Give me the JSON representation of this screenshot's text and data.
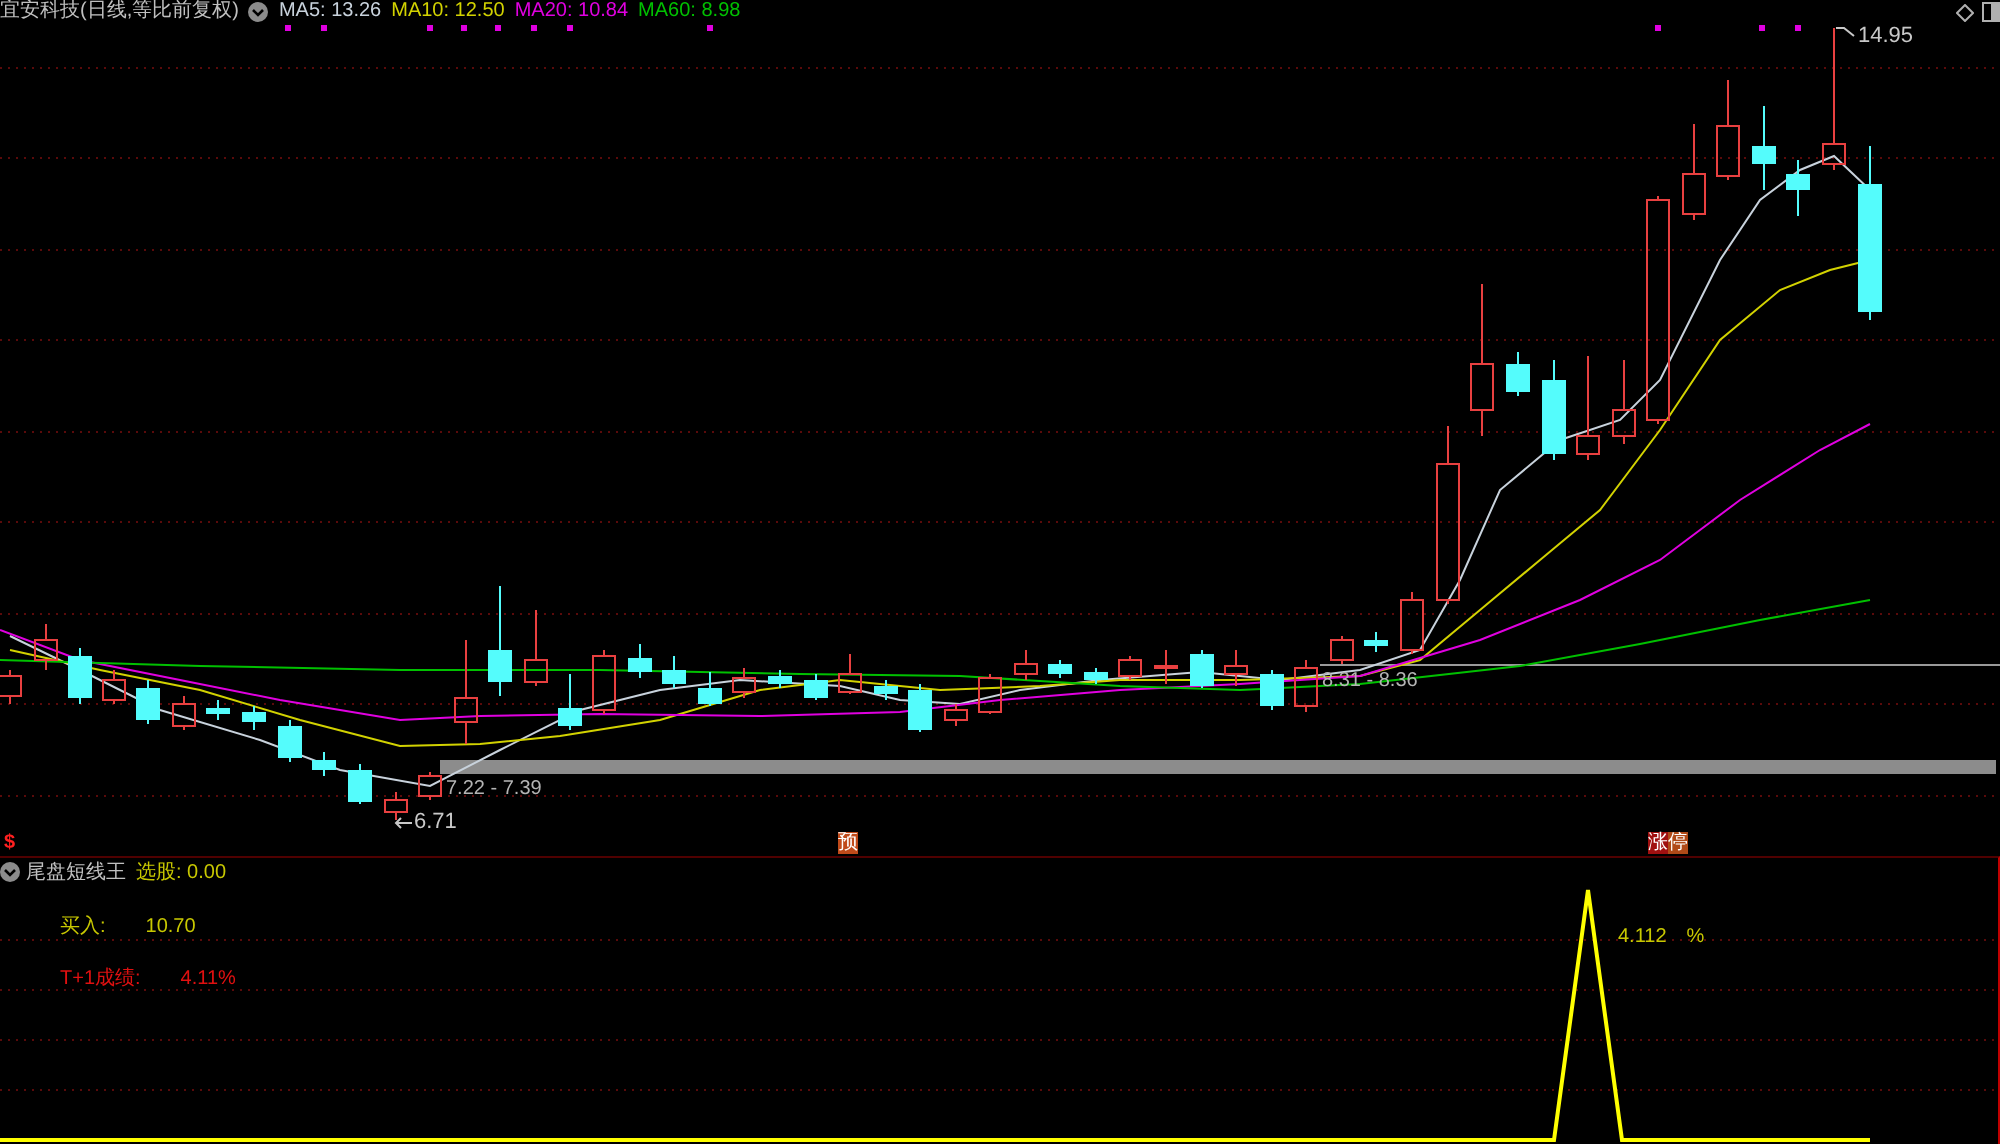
{
  "header": {
    "title": "宜安科技(日线,等比前复权)",
    "moving_averages": [
      {
        "label": "MA5: 13.26",
        "color": "#c8d2dc"
      },
      {
        "label": "MA10: 12.50",
        "color": "#d2d200"
      },
      {
        "label": "MA20: 10.84",
        "color": "#e000e0"
      },
      {
        "label": "MA60: 8.98",
        "color": "#00c000"
      }
    ]
  },
  "price_chart": {
    "high_label": "14.95",
    "low_label": "6.71",
    "ranges": [
      "7.22 - 7.39",
      "8.31 - 8.36"
    ],
    "signal_tags": [
      {
        "text": "$",
        "kind": "text",
        "color": "#ff2020"
      },
      {
        "text": "预",
        "kind": "tag",
        "color": "#c04a1a"
      },
      {
        "text": "涨",
        "kind": "tag",
        "color": "#a01010"
      },
      {
        "text": "停",
        "kind": "tag",
        "color": "#b04a18"
      }
    ]
  },
  "indicator": {
    "name": "尾盘短线王",
    "selection": "选股: 0.00",
    "rows": [
      {
        "label": "买入:",
        "value": "10.70",
        "color": "#c8c800"
      },
      {
        "label": "T+1成绩:",
        "value": "4.11%",
        "color": "#e01010"
      }
    ],
    "peak_value": "4.112",
    "peak_unit": "%"
  }
}
